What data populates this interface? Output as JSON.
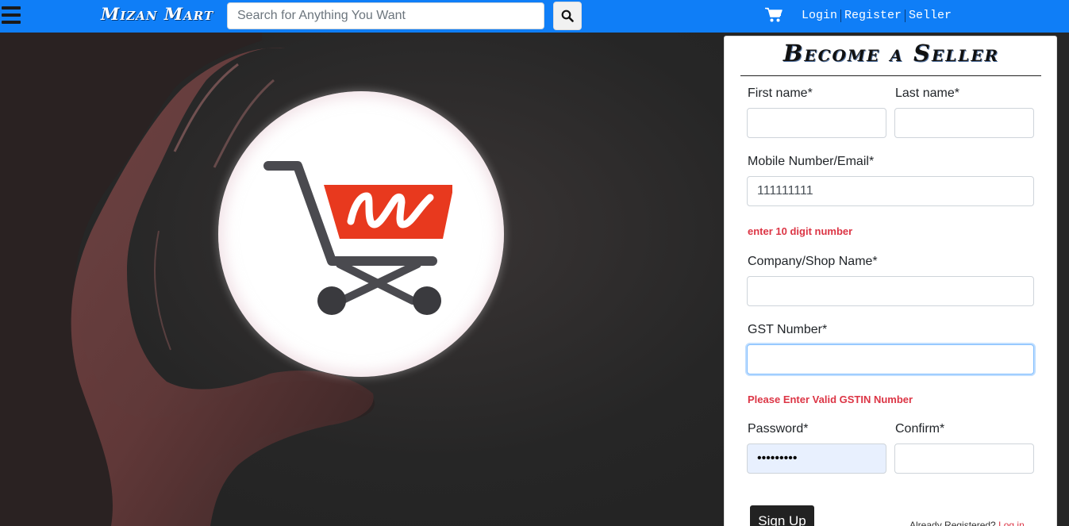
{
  "nav": {
    "brand": "Mizan Mart",
    "search_placeholder": "Search for Anything You Want",
    "links": {
      "login": "Login",
      "register": "Register",
      "seller": "Seller"
    }
  },
  "form": {
    "title": "Become a Seller",
    "first_name": {
      "label": "First name*",
      "value": ""
    },
    "last_name": {
      "label": "Last name*",
      "value": ""
    },
    "mobile": {
      "label": "Mobile Number/Email*",
      "value": "111111111",
      "error": "enter 10 digit number"
    },
    "company": {
      "label": "Company/Shop Name*",
      "value": ""
    },
    "gst": {
      "label": "GST Number*",
      "value": "",
      "error": "Please Enter Valid GSTIN Number"
    },
    "password": {
      "label": "Password*",
      "value": "123456789"
    },
    "confirm": {
      "label": "Confirm*",
      "value": ""
    },
    "signup_label": "Sign Up",
    "already_text": "Already Registered?",
    "login_link": "Log in"
  },
  "colors": {
    "navbar": "#0f7ef7",
    "error": "#dc3545",
    "logo_red": "#e8391e"
  }
}
